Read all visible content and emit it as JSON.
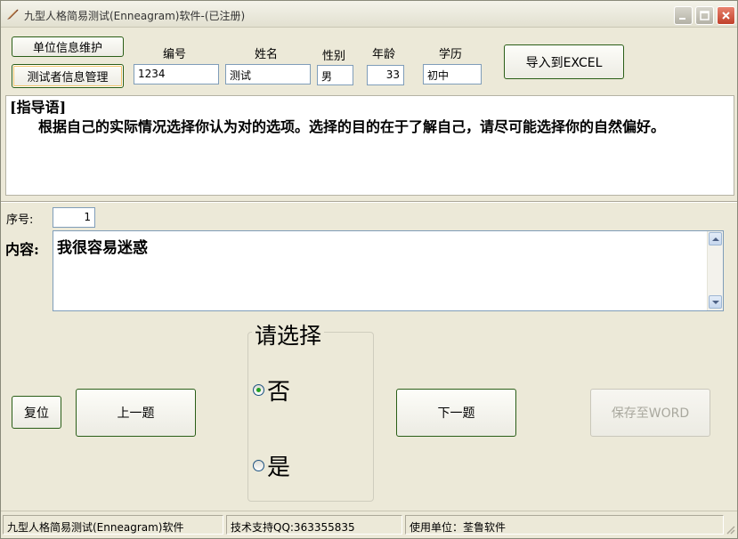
{
  "window": {
    "title": "九型人格简易测试(Enneagram)软件-(已注册)"
  },
  "toolbar": {
    "unit_info_label": "单位信息维护",
    "tester_info_label": "测试者信息管理",
    "export_excel_label": "导入到EXCEL"
  },
  "fields": {
    "id_label": "编号",
    "id_value": "1234",
    "name_label": "姓名",
    "name_value": "测试",
    "gender_label": "性别",
    "gender_value": "男",
    "age_label": "年龄",
    "age_value": "33",
    "education_label": "学历",
    "education_value": "初中"
  },
  "guide": {
    "heading": "[指导语]",
    "text": "根据自己的实际情况选择你认为对的选项。选择的目的在于了解自己，请尽可能选择你的自然偏好。"
  },
  "question": {
    "seq_label": "序号:",
    "seq_value": "1",
    "content_label": "内容:",
    "content_text": "我很容易迷惑"
  },
  "choice": {
    "title": "请选择",
    "options": [
      {
        "label": "否",
        "checked": true
      },
      {
        "label": "是",
        "checked": false
      }
    ]
  },
  "actions": {
    "reset_label": "复位",
    "prev_label": "上一题",
    "next_label": "下一题",
    "save_word_label": "保存至WORD"
  },
  "status": {
    "app_name": "九型人格简易测试(Enneagram)软件",
    "support": "技术支持QQ:363355835",
    "licensee": "使用单位：荃鲁软件"
  },
  "icons": {
    "app": "feather-pen-icon",
    "minimize": "minimize-icon",
    "maximize": "maximize-icon",
    "close": "close-icon",
    "scroll_up": "arrow-up-icon",
    "scroll_down": "arrow-down-icon"
  },
  "colors": {
    "button_border": "#2a5e17",
    "close_button": "#c0402a",
    "radio_dot": "#21a121"
  }
}
